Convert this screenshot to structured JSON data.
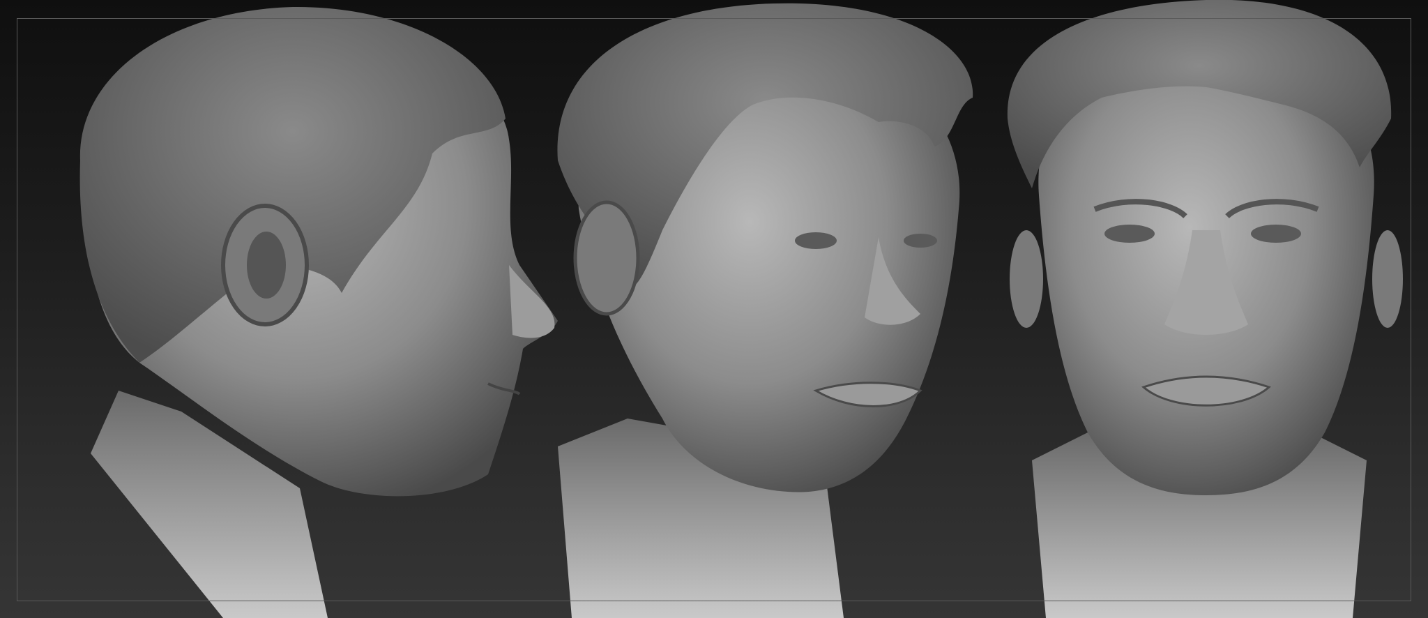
{
  "viewport": {
    "background_top": "#0f0f0f",
    "background_bottom": "#353535",
    "frame_color": "#5a5a5a"
  },
  "sculpt": {
    "material_base": "#8a8a8a",
    "material_highlight": "#c4c4c4",
    "material_shadow": "#3a3a3a",
    "hair_color": "#6e6e6e",
    "views": [
      "profile",
      "three-quarter",
      "front"
    ]
  }
}
